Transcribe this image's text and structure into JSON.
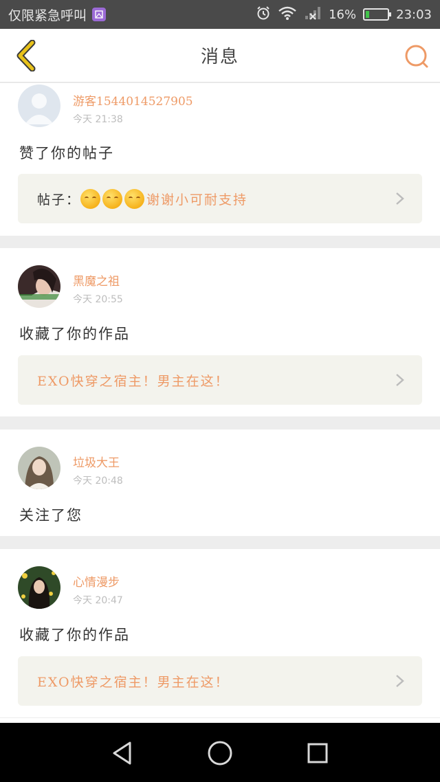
{
  "status_bar": {
    "carrier": "仅限紧急呼叫",
    "battery": "16%",
    "battery_level": 0.16,
    "time": "23:03"
  },
  "header": {
    "title": "消息"
  },
  "notifications": [
    {
      "username": "游客1544014527905",
      "time": "今天 21:38",
      "action": "赞了你的帖子",
      "ref_prefix": "帖子：",
      "ref_emoji_count": 3,
      "ref_title": "谢谢小可耐支持"
    },
    {
      "username": "黑魔之祖",
      "time": "今天 20:55",
      "action": "收藏了你的作品",
      "ref_title": "EXO快穿之宿主！男主在这！"
    },
    {
      "username": "垃圾大王",
      "time": "今天 20:48",
      "action": "关注了您"
    },
    {
      "username": "心情漫步",
      "time": "今天 20:47",
      "action": "收藏了你的作品",
      "ref_title": "EXO快穿之宿主！男主在这！"
    }
  ],
  "colors": {
    "accent": "#ee9a66",
    "back_arrow": "#e8c21a",
    "ref_bg": "#f3f3ed"
  }
}
